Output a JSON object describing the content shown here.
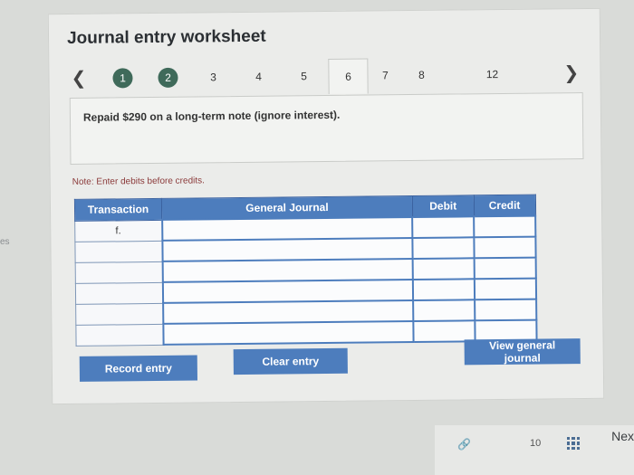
{
  "worksheet": {
    "title": "Journal entry worksheet",
    "nav": {
      "prev_icon": "chevron-left-icon",
      "next_icon": "chevron-right-icon",
      "steps": [
        "1",
        "2",
        "3",
        "4",
        "5",
        "6",
        "7",
        "8",
        "12"
      ],
      "active_step": "6"
    },
    "description": "Repaid $290 on a long-term note (ignore interest).",
    "note": "Note: Enter debits before credits."
  },
  "table": {
    "headers": {
      "transaction": "Transaction",
      "general_journal": "General Journal",
      "debit": "Debit",
      "credit": "Credit"
    },
    "rows": [
      {
        "transaction": "f.",
        "general_journal": "",
        "debit": "",
        "credit": ""
      },
      {
        "transaction": "",
        "general_journal": "",
        "debit": "",
        "credit": ""
      },
      {
        "transaction": "",
        "general_journal": "",
        "debit": "",
        "credit": ""
      },
      {
        "transaction": "",
        "general_journal": "",
        "debit": "",
        "credit": ""
      },
      {
        "transaction": "",
        "general_journal": "",
        "debit": "",
        "credit": ""
      },
      {
        "transaction": "",
        "general_journal": "",
        "debit": "",
        "credit": ""
      }
    ]
  },
  "buttons": {
    "record": "Record entry",
    "clear": "Clear entry",
    "view": "View general journal"
  },
  "page": {
    "side_text": "es",
    "next": "Nex",
    "page_number": "10"
  },
  "colors": {
    "accent": "#4d7dbd",
    "done_step": "#3f6a5a"
  }
}
